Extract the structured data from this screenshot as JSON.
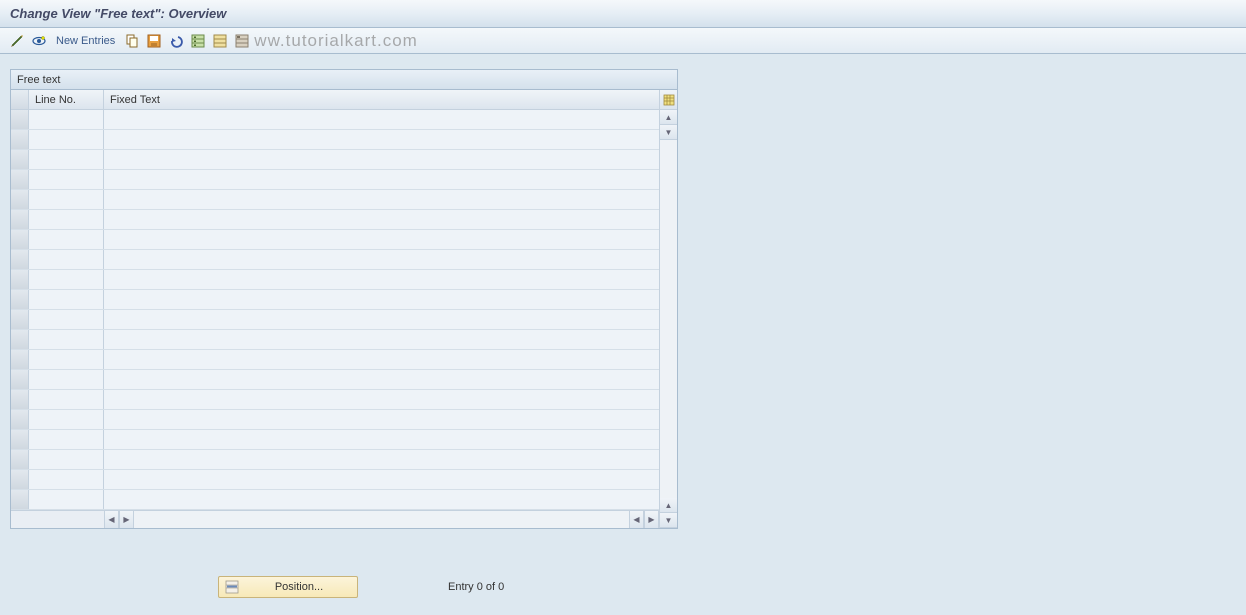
{
  "title": "Change View \"Free text\": Overview",
  "toolbar": {
    "new_entries_label": "New Entries",
    "watermark": "ww.tutorialkart.com"
  },
  "panel": {
    "title": "Free text",
    "columns": {
      "line_no": "Line No.",
      "fixed_text": "Fixed Text"
    },
    "row_count": 20
  },
  "footer": {
    "position_label": "Position...",
    "entry_status": "Entry 0 of 0"
  }
}
